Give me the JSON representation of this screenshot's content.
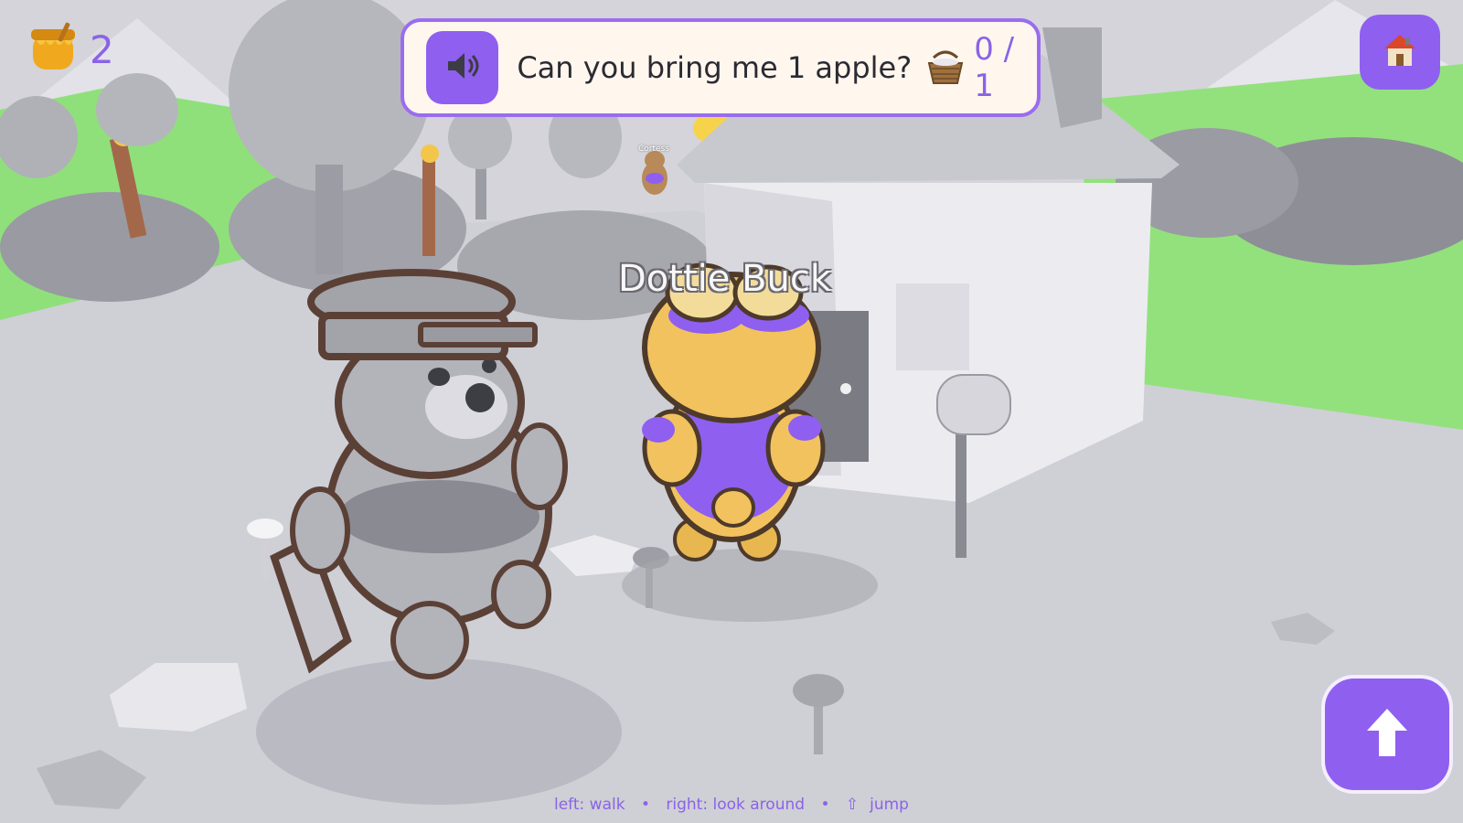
{
  "hud": {
    "honey_count": "2",
    "honey_icon": "honey-pot-icon"
  },
  "quest": {
    "text": "Can you bring me 1 apple?",
    "progress": "0 / 1",
    "speaker_icon": "speaker-icon",
    "item_icon": "apple-basket-icon"
  },
  "npc": {
    "name": "Dottie Buck",
    "distant_name": "Cortess"
  },
  "buttons": {
    "home_icon": "home-icon",
    "jump_icon": "up-arrow-icon"
  },
  "controls": {
    "left": "left: walk",
    "sep1": "•",
    "right": "right: look around",
    "sep2": "•",
    "jump_arrow": "⇧",
    "jump": "jump"
  },
  "colors": {
    "accent": "#8f5ff0",
    "quest_bg": "#fff7ee",
    "player_body": "#f2c25f",
    "player_outfit": "#8f5ff0",
    "sky": "#c9c9d0",
    "grass": "#8fe07a"
  }
}
